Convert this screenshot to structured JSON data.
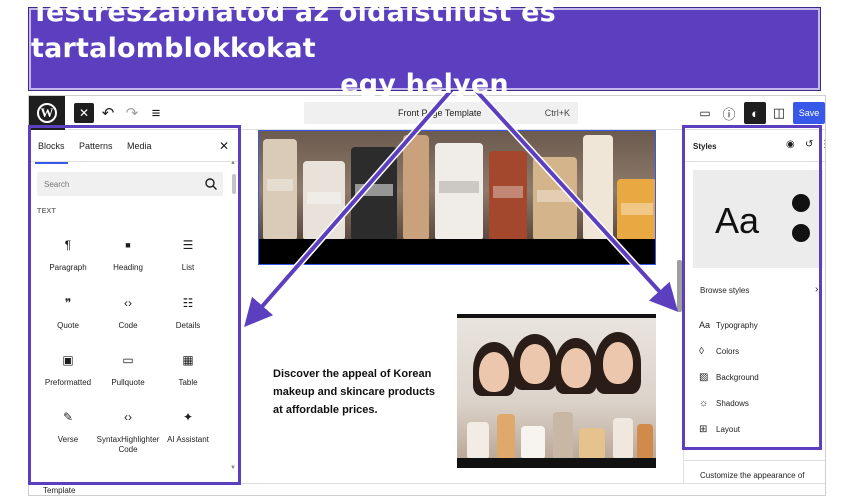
{
  "banner": {
    "line1": "Testreszabhatod az oldalstílust és tartalomblokkokat",
    "line2": "egy helyen"
  },
  "topbar": {
    "logo": "W",
    "close_icon": "close-icon",
    "undo_icon": "undo-icon",
    "redo_icon": "redo-icon",
    "list_view_icon": "list-view-icon",
    "document_title": "Front Page Template",
    "command_shortcut": "Ctrl+K",
    "device_preview_icon": "desktop-icon",
    "help_icon": "help-icon",
    "styles_icon": "half-circle-icon",
    "settings_icon": "sidebar-icon",
    "save_label": "Save"
  },
  "inserter": {
    "tabs": [
      {
        "label": "Blocks",
        "active": true
      },
      {
        "label": "Patterns",
        "active": false
      },
      {
        "label": "Media",
        "active": false
      }
    ],
    "close_glyph": "✕",
    "search_placeholder": "Search",
    "category": "TEXT",
    "blocks": [
      {
        "label": "Paragraph",
        "icon": "¶"
      },
      {
        "label": "Heading",
        "icon": "■"
      },
      {
        "label": "List",
        "icon": "☰"
      },
      {
        "label": "Quote",
        "icon": "❞"
      },
      {
        "label": "Code",
        "icon": "‹›"
      },
      {
        "label": "Details",
        "icon": "☷"
      },
      {
        "label": "Preformatted",
        "icon": "▣"
      },
      {
        "label": "Pullquote",
        "icon": "▭"
      },
      {
        "label": "Table",
        "icon": "▦"
      },
      {
        "label": "Verse",
        "icon": "✎"
      },
      {
        "label": "SyntaxHighlighter Code",
        "icon": "‹›"
      },
      {
        "label": "AI Assistant",
        "icon": "✦"
      }
    ]
  },
  "canvas": {
    "content_text": "Discover the appeal of Korean makeup and skincare products at affordable prices."
  },
  "styles_panel": {
    "title": "Styles",
    "preview_text": "Aa",
    "browse_label": "Browse styles",
    "items": [
      {
        "label": "Typography",
        "icon": "Aa"
      },
      {
        "label": "Colors",
        "icon": "◊"
      },
      {
        "label": "Background",
        "icon": "▨"
      },
      {
        "label": "Shadows",
        "icon": "☼"
      },
      {
        "label": "Layout",
        "icon": "⊞"
      }
    ],
    "description": "Customize the appearance of"
  },
  "footer": {
    "breadcrumb": "Template"
  },
  "colors": {
    "accent": "#5b3fbf",
    "wp_blue": "#3858e9",
    "dark": "#1e1e1e"
  }
}
